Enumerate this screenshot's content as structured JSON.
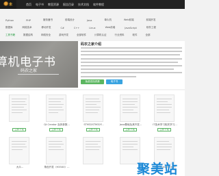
{
  "header": {
    "logo_glyph": "未",
    "nav": [
      "首页",
      "电子书",
      "教室资源",
      "报告目录",
      "技术文档",
      "软件教程"
    ]
  },
  "tags": {
    "row1": [
      "Python",
      "PHP",
      "服务器书",
      "前端设计",
      "Java",
      "单片机",
      "Web前端",
      "前端开发"
    ],
    "row2": [
      "数据库",
      "网络技术",
      "移动开发",
      "C#",
      "C++",
      "Linux",
      "Web前端",
      "JavaScript",
      "软件工程"
    ],
    "row3": [
      "工具书籍",
      "数据结构",
      "网络安全",
      "游戏开发",
      "全部软件",
      "计算机认证",
      "行业资料",
      "软件",
      "全部"
    ]
  },
  "banner": {
    "title": "算机电子书",
    "subtitle": "码农之家"
  },
  "intro": {
    "title": "码农之家介绍",
    "buttons": [
      "免费查找资源",
      "电子书"
    ]
  },
  "cards_row1": [
    {
      "title": "",
      "button": "立即下载"
    },
    {
      "title": "Qt Creator 及其参数...",
      "button": "立即下载"
    },
    {
      "title": "STM32STM32F...",
      "button": "立即下载"
    },
    {
      "title": "Java基础及其开发...",
      "button": "立即下载"
    },
    {
      "title": "IT技术学习相关学习...",
      "button": "立即下载"
    }
  ],
  "cards_row2": [
    {
      "title": "大众..."
    },
    {
      "title": "角色开发（H35X0）..."
    },
    {
      "title": ""
    },
    {
      "title": ""
    },
    {
      "title": "DSP specification"
    }
  ],
  "watermark": "聚美站"
}
